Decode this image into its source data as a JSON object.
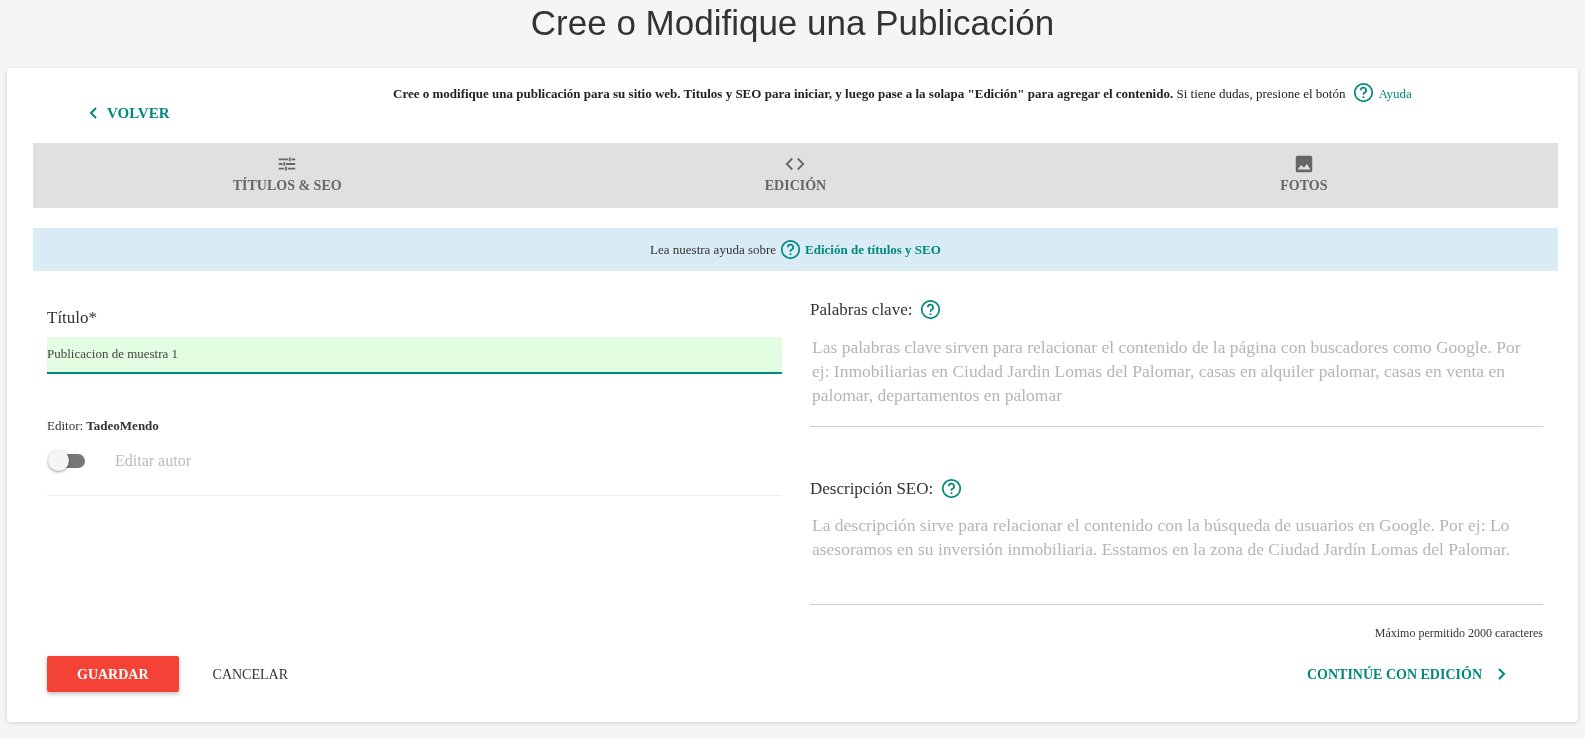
{
  "page_title": "Cree o Modifique una Publicación",
  "back_link": "VOLVER",
  "intro": {
    "text": "**Cree o modifique una publicación para su sitio web. Titulos y SEO para iniciar, y luego pase a la solapa \"Edición\" para agregar el contenido.** Si tiene dudas, presione el botón",
    "help_link": "Ayuda"
  },
  "tabs": [
    {
      "label": "TÍTULOS & SEO",
      "kind": "settings",
      "selected": false
    },
    {
      "label": "EDICIÓN",
      "kind": "editor",
      "selected": false
    },
    {
      "label": "FOTOS",
      "kind": "photos",
      "selected": false
    }
  ],
  "help_banner": {
    "text": "Lea nuestra ayuda sobre",
    "link": "Edición de títulos y SEO"
  },
  "title_field": {
    "label": "Título*",
    "value": "Publicacion de muestra 1",
    "valid": true
  },
  "editor": {
    "label": "Editor:",
    "name": "TadeoMendo"
  },
  "edit_author_toggle": {
    "label": "Editar autor",
    "on": false
  },
  "keywords_field": {
    "label": "Palabras clave:",
    "placeholder": "Las palabras clave sirven para relacionar el contenido de la página con buscadores como Google. Por ej: Inmobiliarias en Ciudad Jardin Lomas del Palomar, casas en alquiler palomar, casas en venta en palomar, departamentos en palomar"
  },
  "description_field": {
    "label": "Descripción SEO:",
    "placeholder": "La descripción sirve para relacionar el contenido con la búsqueda de usuarios en Google. Por ej: Lo asesoramos en su inversión inmobiliaria. Esstamos en la zona de Ciudad Jardín Lomas del Palomar.",
    "hint": "Máximo permitido 2000 caracteres"
  },
  "buttons": {
    "save": "GUARDAR",
    "cancel": "CANCELAR",
    "next": "CONTINÚE CON EDICIÓN"
  }
}
